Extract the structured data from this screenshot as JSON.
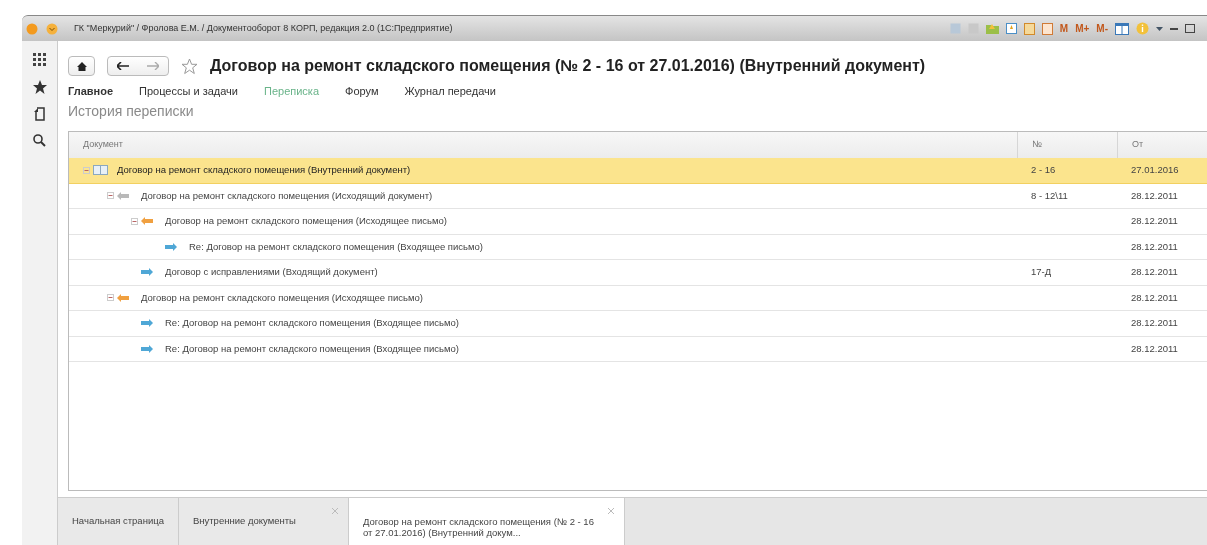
{
  "window": {
    "title": "ГК \"Меркурий\" / Фролова Е.М. / Документооборот 8 КОРП, редакция 2.0  (1С:Предприятие)",
    "toolbar_labels": [
      "M",
      "M+",
      "M-"
    ]
  },
  "document": {
    "title": "Договор на ремонт складского помещения (№ 2 - 16 от 27.01.2016) (Внутренний документ)"
  },
  "nav": [
    {
      "label": "Главное",
      "kind": "main",
      "selected": false
    },
    {
      "label": "Процессы и задачи",
      "kind": "link",
      "selected": false
    },
    {
      "label": "Переписка",
      "kind": "link",
      "selected": true
    },
    {
      "label": "Форум",
      "kind": "link",
      "selected": false
    },
    {
      "label": "Журнал передачи",
      "kind": "link",
      "selected": false
    }
  ],
  "section_title": "История переписки",
  "table": {
    "columns": [
      "Документ",
      "№",
      "От"
    ],
    "rows": [
      {
        "kind": "internal",
        "name": "Договор на ремонт складского помещения (Внутренний документ)",
        "number": "2 - 16",
        "date": "27.01.2016",
        "selected": true,
        "expanded": true,
        "children": [
          {
            "kind": "outgoing-document",
            "name": "Договор на ремонт складского помещения (Исходящий документ)",
            "number": "8 - 12\\11",
            "date": "28.12.2011",
            "selected": false,
            "expanded": true,
            "children": [
              {
                "kind": "outgoing-letter",
                "name": "Договор на ремонт складского помещения (Исходящее письмо)",
                "date": "28.12.2011",
                "selected": false,
                "expanded": true,
                "children": [
                  {
                    "kind": "incoming",
                    "name": "Re: Договор на ремонт складского помещения (Входящее письмо)",
                    "date": "28.12.2011",
                    "selected": false
                  }
                ]
              },
              {
                "kind": "incoming",
                "name": "Договор с исправлениями (Входящий документ)",
                "number": "17-Д",
                "date": "28.12.2011",
                "selected": false
              }
            ]
          },
          {
            "kind": "outgoing-letter",
            "name": "Договор на ремонт складского помещения (Исходящее письмо)",
            "date": "28.12.2011",
            "selected": false,
            "expanded": true,
            "children": [
              {
                "kind": "incoming",
                "name": "Re: Договор на ремонт складского помещения (Входящее письмо)",
                "date": "28.12.2011",
                "selected": false
              },
              {
                "kind": "incoming",
                "name": "Re: Договор на ремонт складского помещения (Входящее письмо)",
                "date": "28.12.2011",
                "selected": false
              }
            ]
          }
        ]
      }
    ]
  },
  "open_tabs": [
    {
      "label": "Начальная страница",
      "closable": false,
      "selected": false
    },
    {
      "label": "Внутренние документы",
      "closable": true,
      "selected": false
    },
    {
      "label": "Договор на ремонт складского помещения (№ 2 - 16 от 27.01.2016) (Внутренний докум...",
      "closable": true,
      "selected": true
    }
  ]
}
